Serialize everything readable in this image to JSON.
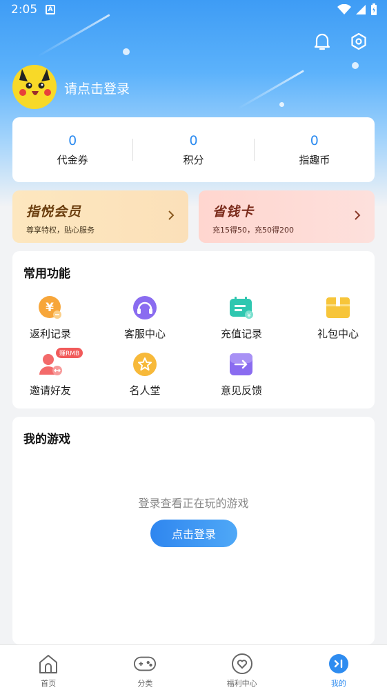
{
  "status_bar": {
    "time": "2:05",
    "notif_letter": "A"
  },
  "header": {
    "login_prompt": "请点击登录"
  },
  "stats": [
    {
      "value": "0",
      "label": "代金券"
    },
    {
      "value": "0",
      "label": "积分"
    },
    {
      "value": "0",
      "label": "指趣币"
    }
  ],
  "promos": {
    "vip": {
      "title": "指悦会员",
      "subtitle": "尊享特权，贴心服务",
      "title_color": "#6b3e0e"
    },
    "save": {
      "title": "省钱卡",
      "subtitle": "充15得50，充50得200",
      "title_color": "#7a2a1a"
    }
  },
  "functions": {
    "title": "常用功能",
    "items": [
      {
        "label": "返利记录",
        "icon": "rebate-icon",
        "color": "#f7a63a"
      },
      {
        "label": "客服中心",
        "icon": "headset-icon",
        "color": "#8a6cf0"
      },
      {
        "label": "充值记录",
        "icon": "recharge-icon",
        "color": "#2fc7b0"
      },
      {
        "label": "礼包中心",
        "icon": "gift-icon",
        "color": "#f7c53a"
      },
      {
        "label": "邀请好友",
        "icon": "invite-icon",
        "color": "#f36a6a",
        "badge": "赚RMB"
      },
      {
        "label": "名人堂",
        "icon": "star-icon",
        "color": "#f7b93a"
      },
      {
        "label": "意见反馈",
        "icon": "feedback-icon",
        "color": "#8a6cf0"
      }
    ]
  },
  "games": {
    "title": "我的游戏",
    "empty_text": "登录查看正在玩的游戏",
    "login_button": "点击登录"
  },
  "tabbar": [
    {
      "label": "首页",
      "icon": "home-icon",
      "active": false
    },
    {
      "label": "分类",
      "icon": "gamepad-icon",
      "active": false
    },
    {
      "label": "福利中心",
      "icon": "heart-icon",
      "active": false
    },
    {
      "label": "我的",
      "icon": "profile-icon",
      "active": true
    }
  ],
  "colors": {
    "accent": "#2e8cf0",
    "header_top": "#3e9cf5"
  }
}
